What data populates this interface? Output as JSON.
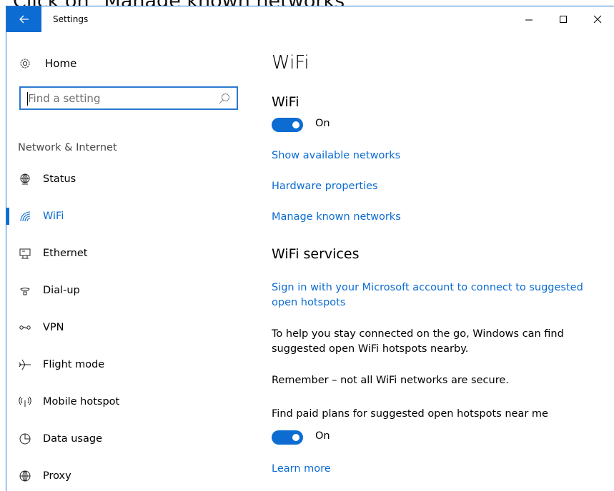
{
  "caption": "Click on \"Manage known networks\"",
  "window": {
    "title": "Settings",
    "controls": {
      "minimize": "–",
      "maximize": "☐",
      "close": "✕"
    }
  },
  "sidebar": {
    "home_label": "Home",
    "search_placeholder": "Find a setting",
    "section_header": "Network & Internet",
    "items": [
      {
        "label": "Status",
        "icon": "globe-icon"
      },
      {
        "label": "WiFi",
        "icon": "wifi-icon",
        "active": true
      },
      {
        "label": "Ethernet",
        "icon": "ethernet-icon"
      },
      {
        "label": "Dial-up",
        "icon": "dialup-icon"
      },
      {
        "label": "VPN",
        "icon": "vpn-icon"
      },
      {
        "label": "Flight mode",
        "icon": "airplane-icon"
      },
      {
        "label": "Mobile hotspot",
        "icon": "hotspot-icon"
      },
      {
        "label": "Data usage",
        "icon": "data-usage-icon"
      },
      {
        "label": "Proxy",
        "icon": "proxy-globe-icon"
      }
    ]
  },
  "main": {
    "page_title": "WiFi",
    "wifi_section_title": "WiFi",
    "wifi_toggle_label": "On",
    "links": {
      "show_networks": "Show available networks",
      "hardware_properties": "Hardware properties",
      "manage_known": "Manage known networks"
    },
    "services_title": "WiFi services",
    "signin_link": "Sign in with your Microsoft account to connect to suggested open hotspots",
    "help_text": "To help you stay connected on the go, Windows can find suggested open WiFi hotspots nearby.",
    "remember_text": "Remember – not all WiFi networks are secure.",
    "paid_plans_text": "Find paid plans for suggested open hotspots near me",
    "paid_toggle_label": "On",
    "learn_more": "Learn more"
  },
  "colors": {
    "accent": "#0c6cd1"
  }
}
